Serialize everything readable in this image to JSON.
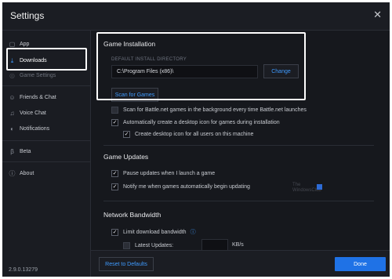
{
  "window": {
    "title": "Settings",
    "close_glyph": "✕"
  },
  "sidebar": {
    "items": [
      {
        "label": "App",
        "icon": "app-icon"
      },
      {
        "label": "Downloads",
        "icon": "download-icon"
      },
      {
        "label": "Game Settings",
        "icon": "gamepad-icon"
      },
      {
        "label": "Friends & Chat",
        "icon": "friends-icon"
      },
      {
        "label": "Voice Chat",
        "icon": "voice-chat-icon"
      },
      {
        "label": "Notifications",
        "icon": "bell-icon"
      },
      {
        "label": "Beta",
        "icon": "beta-icon"
      },
      {
        "label": "About",
        "icon": "info-icon"
      }
    ],
    "version": "2.9.0.13279"
  },
  "game_installation": {
    "title": "Game Installation",
    "dir_label": "DEFAULT INSTALL DIRECTORY",
    "dir_value": "C:\\Program Files (x86)\\",
    "change_label": "Change",
    "scan_label": "Scan for Games",
    "options": [
      {
        "label": "Scan for Battle.net games in the background every time Battle.net launches",
        "checked": false
      },
      {
        "label": "Automatically create a desktop icon for games during installation",
        "checked": true
      },
      {
        "label": "Create desktop icon for all users on this machine",
        "checked": true
      }
    ]
  },
  "game_updates": {
    "title": "Game Updates",
    "options": [
      {
        "label": "Pause updates when I launch a game",
        "checked": true
      },
      {
        "label": "Notify me when games automatically begin updating",
        "checked": true
      }
    ]
  },
  "network_bandwidth": {
    "title": "Network Bandwidth",
    "limit_label": "Limit download bandwidth",
    "latest_updates_label": "Latest Updates:",
    "unit": "KB/s"
  },
  "watermark": {
    "line1": "The",
    "line2": "WindowsClub"
  },
  "footer": {
    "reset_label": "Reset to Defaults",
    "done_label": "Done"
  },
  "colors": {
    "accent": "#1f72e6",
    "link": "#3f9bff",
    "background": "#16181d"
  }
}
